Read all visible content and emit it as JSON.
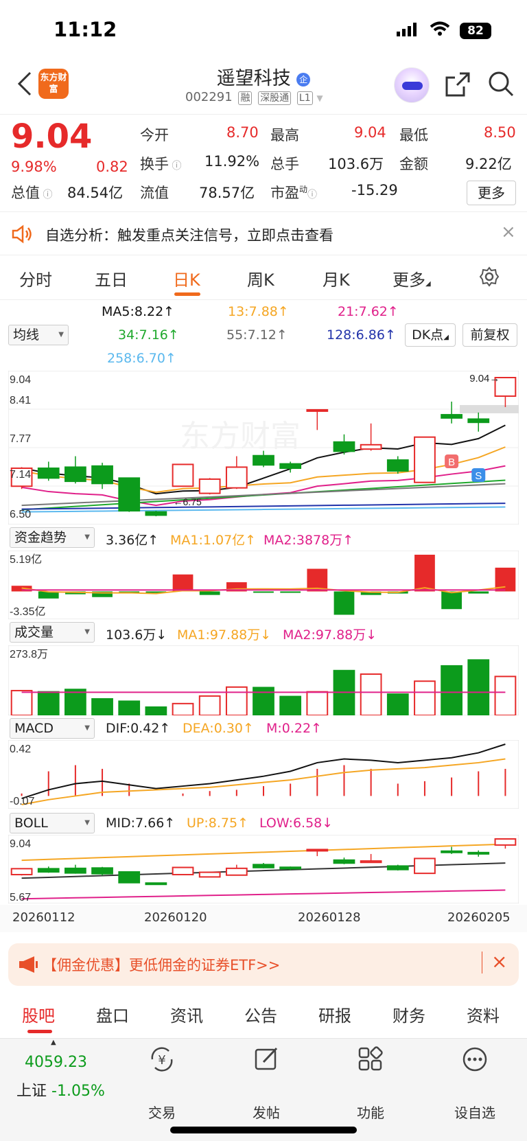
{
  "status_bar": {
    "time": "11:12",
    "battery": "82"
  },
  "header": {
    "stock_name": "遥望科技",
    "stock_code": "002291",
    "tags": [
      "融",
      "深股通",
      "L1"
    ],
    "logo_text": "东方财富"
  },
  "quote": {
    "price": "9.04",
    "change_pct": "9.98%",
    "change": "0.82",
    "fields": [
      {
        "label": "今开",
        "value": "8.70"
      },
      {
        "label": "最高",
        "value": "9.04"
      },
      {
        "label": "最低",
        "value": "8.50"
      },
      {
        "label": "换手",
        "value": "11.92%"
      },
      {
        "label": "总手",
        "value": "103.6万"
      },
      {
        "label": "金额",
        "value": "9.22亿"
      },
      {
        "label": "总值",
        "value": "84.54亿"
      },
      {
        "label": "流值",
        "value": "78.57亿"
      },
      {
        "label": "市盈",
        "value": "-15.29"
      }
    ],
    "pe_sup": "动",
    "more_label": "更多"
  },
  "notice": {
    "text": "自选分析：触发重点关注信号，立即点击查看"
  },
  "period_tabs": [
    "分时",
    "五日",
    "日K",
    "周K",
    "月K",
    "更多"
  ],
  "ma": {
    "selector": "均线",
    "values": [
      "MA5:8.22↑",
      "13:7.88↑",
      "21:7.62↑",
      "34:7.16↑",
      "55:7.12↑",
      "128:6.86↑",
      "258:6.70↑"
    ],
    "dk_label": "DK点",
    "fq_label": "前复权"
  },
  "colors": {
    "up": "#e62a2a",
    "down": "#0c9b1c",
    "accent": "#f06a1c",
    "ma5": "#111111",
    "ma13": "#f5a623",
    "ma21": "#e0208a",
    "ma34": "#1fa82c",
    "ma55": "#777777",
    "ma128": "#2233aa",
    "ma258": "#5ab8ee"
  },
  "kline": {
    "y_labels": [
      "9.04",
      "8.41",
      "7.77",
      "7.14",
      "6.50"
    ],
    "low_marker": "6.75",
    "high_marker": "9.04",
    "buy_marker": "B",
    "sell_marker": "S",
    "watermark": "东方财富"
  },
  "fund": {
    "selector": "资金趋势",
    "value": "3.36亿↑",
    "ma1": "MA1:1.07亿↑",
    "ma2": "MA2:3878万↑",
    "y_max": "5.19亿",
    "y_min": "-3.35亿"
  },
  "volume": {
    "selector": "成交量",
    "value": "103.6万↓",
    "ma1": "MA1:97.88万↓",
    "ma2": "MA2:97.88万↓",
    "y_max": "273.8万"
  },
  "macd": {
    "selector": "MACD",
    "dif": "DIF:0.42↑",
    "dea": "DEA:0.30↑",
    "m": "M:0.22↑",
    "y_max": "0.42",
    "y_min": "-0.07"
  },
  "boll": {
    "selector": "BOLL",
    "mid": "MID:7.66↑",
    "up": "UP:8.75↑",
    "low": "LOW:6.58↓",
    "y_max": "9.04",
    "y_min": "5.67"
  },
  "dates": [
    "20260112",
    "20260120",
    "20260128",
    "20260205"
  ],
  "chart_data": {
    "type": "candlestick",
    "categories": [
      "1",
      "2",
      "3",
      "4",
      "5",
      "6",
      "7",
      "8",
      "9",
      "10",
      "11",
      "12",
      "13",
      "14",
      "15",
      "16",
      "17",
      "18",
      "19"
    ],
    "open": [
      7.05,
      7.38,
      7.4,
      7.42,
      7.2,
      6.58,
      7.05,
      6.92,
      7.02,
      7.61,
      7.46,
      8.45,
      7.86,
      7.73,
      7.53,
      7.12,
      8.36,
      8.28,
      8.7
    ],
    "close": [
      7.38,
      7.2,
      7.14,
      7.1,
      6.6,
      6.52,
      7.45,
      7.18,
      7.4,
      7.44,
      7.38,
      8.45,
      7.69,
      7.81,
      7.33,
      7.95,
      8.3,
      8.22,
      9.04
    ],
    "high": [
      7.4,
      7.5,
      7.6,
      7.48,
      7.2,
      6.6,
      7.46,
      7.2,
      7.6,
      7.7,
      7.5,
      8.45,
      8.0,
      8.2,
      7.6,
      7.95,
      8.6,
      8.4,
      9.04
    ],
    "low": [
      7.0,
      7.15,
      7.1,
      7.0,
      6.58,
      6.5,
      7.05,
      6.9,
      7.0,
      7.4,
      7.3,
      8.08,
      7.63,
      7.7,
      7.28,
      7.12,
      8.2,
      8.05,
      8.5
    ],
    "ylim": [
      6.5,
      9.04
    ],
    "volume": [
      105,
      100,
      110,
      70,
      60,
      35,
      50,
      82,
      120,
      118,
      80,
      100,
      190,
      175,
      90,
      145,
      210,
      235,
      165
    ],
    "fund": [
      0.8,
      -1.0,
      -0.4,
      -0.8,
      -0.2,
      -0.1,
      2.4,
      -0.5,
      1.3,
      -0.1,
      -0.2,
      3.2,
      -3.3,
      -0.5,
      -0.3,
      5.19,
      -2.5,
      -0.3,
      3.36
    ],
    "macd_hist": [
      0.02,
      0.2,
      0.25,
      0.22,
      0.1,
      0.0,
      0.02,
      0.04,
      0.05,
      0.08,
      0.1,
      0.22,
      0.25,
      0.22,
      0.1,
      0.12,
      0.15,
      0.2,
      0.22
    ],
    "dif": [
      -0.02,
      0.05,
      0.1,
      0.12,
      0.09,
      0.06,
      0.08,
      0.1,
      0.13,
      0.16,
      0.2,
      0.27,
      0.3,
      0.29,
      0.27,
      0.29,
      0.31,
      0.35,
      0.42
    ],
    "dea": [
      -0.07,
      -0.03,
      0.0,
      0.03,
      0.04,
      0.05,
      0.06,
      0.07,
      0.09,
      0.11,
      0.13,
      0.16,
      0.19,
      0.21,
      0.22,
      0.23,
      0.25,
      0.27,
      0.3
    ]
  },
  "promo": {
    "text": "【佣金优惠】更低佣金的证券ETF>>"
  },
  "bottom_tabs": [
    "股吧",
    "盘口",
    "资讯",
    "公告",
    "研报",
    "财务",
    "资料"
  ],
  "nav": {
    "index_value": "4059.23",
    "index_name": "上证",
    "index_change": "-1.05%",
    "items": [
      "交易",
      "发帖",
      "功能",
      "设自选"
    ]
  }
}
